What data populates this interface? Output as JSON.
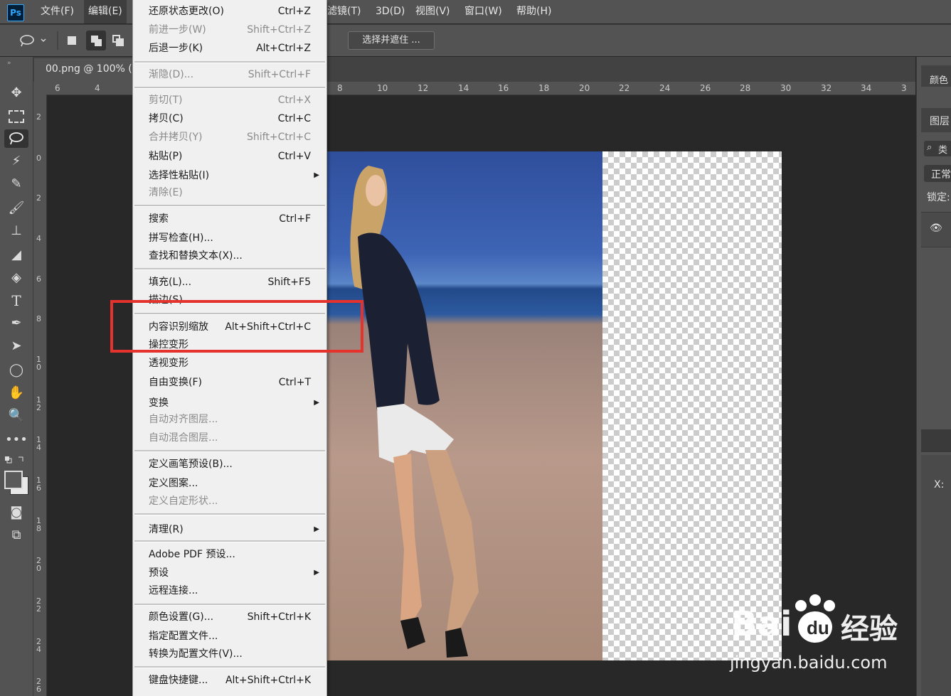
{
  "menubar": {
    "logo": "Ps",
    "items": [
      "文件(F)",
      "编辑(E)",
      "滤镜(T)",
      "3D(D)",
      "视图(V)",
      "窗口(W)",
      "帮助(H)"
    ]
  },
  "options_bar": {
    "select_mask_label": "选择并遮住 ..."
  },
  "document": {
    "tab_title": "00.png @ 100% (",
    "h_ruler_left": [
      "6",
      "4"
    ],
    "h_ruler_right": [
      "8",
      "10",
      "12",
      "14",
      "16",
      "18",
      "20",
      "22",
      "24",
      "26",
      "28",
      "30",
      "32",
      "34",
      "3"
    ],
    "v_ruler": [
      [
        "2"
      ],
      [
        "0"
      ],
      [
        "2"
      ],
      [
        "4"
      ],
      [
        "6"
      ],
      [
        "8"
      ],
      [
        "1",
        "0"
      ],
      [
        "1",
        "2"
      ],
      [
        "1",
        "4"
      ],
      [
        "1",
        "6"
      ],
      [
        "1",
        "8"
      ],
      [
        "2",
        "0"
      ],
      [
        "2",
        "2"
      ],
      [
        "2",
        "4"
      ],
      [
        "2",
        "6"
      ]
    ]
  },
  "right_panel": {
    "color_tab": "颜色",
    "layers_tab": "图层",
    "search_kind": "类",
    "blend_mode": "正常",
    "lock_label": "锁定:",
    "x_label": "X:"
  },
  "edit_menu": {
    "items": [
      {
        "label": "还原状态更改(O)",
        "shortcut": "Ctrl+Z",
        "enabled": true
      },
      {
        "label": "前进一步(W)",
        "shortcut": "Shift+Ctrl+Z",
        "enabled": false
      },
      {
        "label": "后退一步(K)",
        "shortcut": "Alt+Ctrl+Z",
        "enabled": true
      },
      {
        "label": "渐隐(D)...",
        "shortcut": "Shift+Ctrl+F",
        "enabled": false
      },
      {
        "label": "剪切(T)",
        "shortcut": "Ctrl+X",
        "enabled": false
      },
      {
        "label": "拷贝(C)",
        "shortcut": "Ctrl+C",
        "enabled": true
      },
      {
        "label": "合并拷贝(Y)",
        "shortcut": "Shift+Ctrl+C",
        "enabled": false
      },
      {
        "label": "粘贴(P)",
        "shortcut": "Ctrl+V",
        "enabled": true
      },
      {
        "label": "选择性粘贴(I)",
        "shortcut": "",
        "enabled": true,
        "submenu": true
      },
      {
        "label": "清除(E)",
        "shortcut": "",
        "enabled": false
      },
      {
        "label": "搜索",
        "shortcut": "Ctrl+F",
        "enabled": true
      },
      {
        "label": "拼写检查(H)...",
        "shortcut": "",
        "enabled": true
      },
      {
        "label": "查找和替换文本(X)...",
        "shortcut": "",
        "enabled": true
      },
      {
        "label": "填充(L)...",
        "shortcut": "Shift+F5",
        "enabled": true
      },
      {
        "label": "描边(S)...",
        "shortcut": "",
        "enabled": true
      },
      {
        "label": "内容识别缩放",
        "shortcut": "Alt+Shift+Ctrl+C",
        "enabled": true
      },
      {
        "label": "操控变形",
        "shortcut": "",
        "enabled": true
      },
      {
        "label": "透视变形",
        "shortcut": "",
        "enabled": true
      },
      {
        "label": "自由变换(F)",
        "shortcut": "Ctrl+T",
        "enabled": true
      },
      {
        "label": "变换",
        "shortcut": "",
        "enabled": true,
        "submenu": true
      },
      {
        "label": "自动对齐图层...",
        "shortcut": "",
        "enabled": false
      },
      {
        "label": "自动混合图层...",
        "shortcut": "",
        "enabled": false
      },
      {
        "label": "定义画笔预设(B)...",
        "shortcut": "",
        "enabled": true
      },
      {
        "label": "定义图案...",
        "shortcut": "",
        "enabled": true
      },
      {
        "label": "定义自定形状...",
        "shortcut": "",
        "enabled": false
      },
      {
        "label": "清理(R)",
        "shortcut": "",
        "enabled": true,
        "submenu": true
      },
      {
        "label": "Adobe PDF 预设...",
        "shortcut": "",
        "enabled": true
      },
      {
        "label": "预设",
        "shortcut": "",
        "enabled": true,
        "submenu": true
      },
      {
        "label": "远程连接...",
        "shortcut": "",
        "enabled": true
      },
      {
        "label": "颜色设置(G)...",
        "shortcut": "Shift+Ctrl+K",
        "enabled": true
      },
      {
        "label": "指定配置文件...",
        "shortcut": "",
        "enabled": true
      },
      {
        "label": "转换为配置文件(V)...",
        "shortcut": "",
        "enabled": true
      },
      {
        "label": "键盘快捷键...",
        "shortcut": "Alt+Shift+Ctrl+K",
        "enabled": true
      }
    ]
  },
  "watermark": {
    "brand": "Bai",
    "brand2": "经验",
    "url": "jingyan.baidu.com"
  },
  "colors": {
    "highlight_box": "#e5322d",
    "ps_blue": "#31a8ff"
  }
}
